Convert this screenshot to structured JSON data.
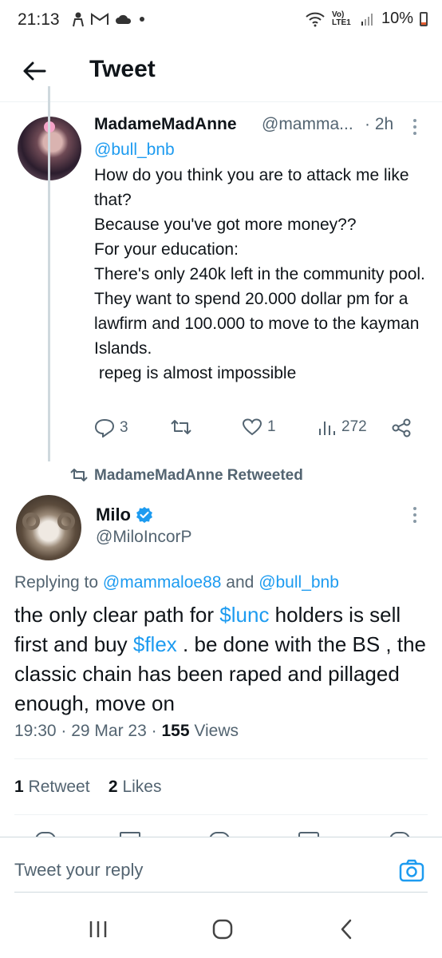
{
  "statusbar": {
    "time": "21:13",
    "battery": "10%",
    "network": "Vo) LTE1"
  },
  "header": {
    "title": "Tweet"
  },
  "tweet1": {
    "name": "MadameMadAnne",
    "handle": "@mamma...",
    "time": "· 2h",
    "reply_to": "@bull_bnb",
    "lines": [
      "How do you think you are to attack me like that?",
      "Because you've got more money??",
      "For your education:",
      "There's only 240k left in the community pool.",
      "They want to spend 20.000 dollar pm for a lawfirm and 100.000 to move to the kayman Islands.",
      " repeg is almost impossible"
    ],
    "replies": "3",
    "likes": "1",
    "views": "272"
  },
  "retweet_banner": "MadameMadAnne Retweeted",
  "tweet2": {
    "name": "Milo",
    "handle": "@MiloIncorP",
    "replying_prefix": "Replying to",
    "replying_user1": "@mammaloe88",
    "replying_and": "and",
    "replying_user2": "@bull_bnb",
    "body_part1": "the only clear path for",
    "cashtag1": "$lunc",
    "body_part2": "holders is sell first and buy",
    "cashtag2": "$flex",
    "body_part3": ". be done with the BS , the classic chain has been raped and pillaged enough, move on",
    "time": "19:30",
    "date": "29 Mar 23",
    "views_count": "155",
    "views_label": "Views",
    "retweet_count": "1",
    "retweet_label": "Retweet",
    "likes_count": "2",
    "likes_label": "Likes"
  },
  "reply_bar": {
    "placeholder": "Tweet your reply"
  },
  "colors": {
    "accent": "#1d9bf0",
    "muted": "#536471",
    "text": "#0f1419"
  }
}
